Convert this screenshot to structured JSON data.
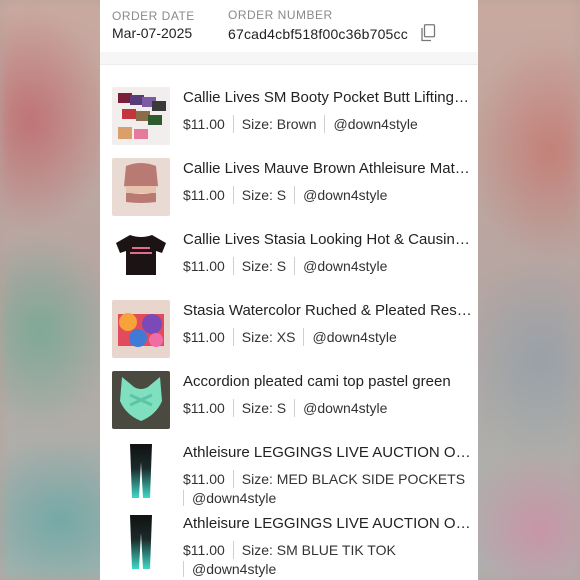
{
  "order": {
    "date_label": "ORDER DATE",
    "date_value": "Mar-07-2025",
    "number_label": "ORDER NUMBER",
    "number_value": "67cad4cbf518f00c36b705cc",
    "copy_icon": "copy-icon"
  },
  "items": [
    {
      "title": "Callie Lives SM Booty Pocket Butt Lifting Shorts",
      "price": "$11.00",
      "size": "Size: Brown",
      "seller": "@down4style",
      "thumb": "shorts-stack"
    },
    {
      "title": "Callie Lives Mauve Brown Athleisure Matching Set",
      "price": "$11.00",
      "size": "Size: S",
      "seller": "@down4style",
      "thumb": "mauve-set"
    },
    {
      "title": "Callie Lives Stasia Looking Hot & Causing Chaos Tee",
      "price": "$11.00",
      "size": "Size: S",
      "seller": "@down4style",
      "thumb": "black-tee"
    },
    {
      "title": "Stasia Watercolor Ruched & Pleated Resort Top",
      "price": "$11.00",
      "size": "Size: XS",
      "seller": "@down4style",
      "thumb": "tie-dye-top"
    },
    {
      "title": "Accordion pleated cami top pastel green",
      "price": "$11.00",
      "size": "Size: S",
      "seller": "@down4style",
      "thumb": "green-cami"
    },
    {
      "title": "Athleisure LEGGINGS LIVE AUCTION ONLY",
      "price": "$11.00",
      "size": "Size: MED BLACK SIDE POCKETS",
      "seller": "@down4style",
      "thumb": "ombre-leggings"
    },
    {
      "title": "Athleisure LEGGINGS LIVE AUCTION ONLY",
      "price": "$11.00",
      "size": "Size: SM BLUE TIK TOK",
      "seller": "@down4style",
      "thumb": "ombre-leggings"
    }
  ]
}
